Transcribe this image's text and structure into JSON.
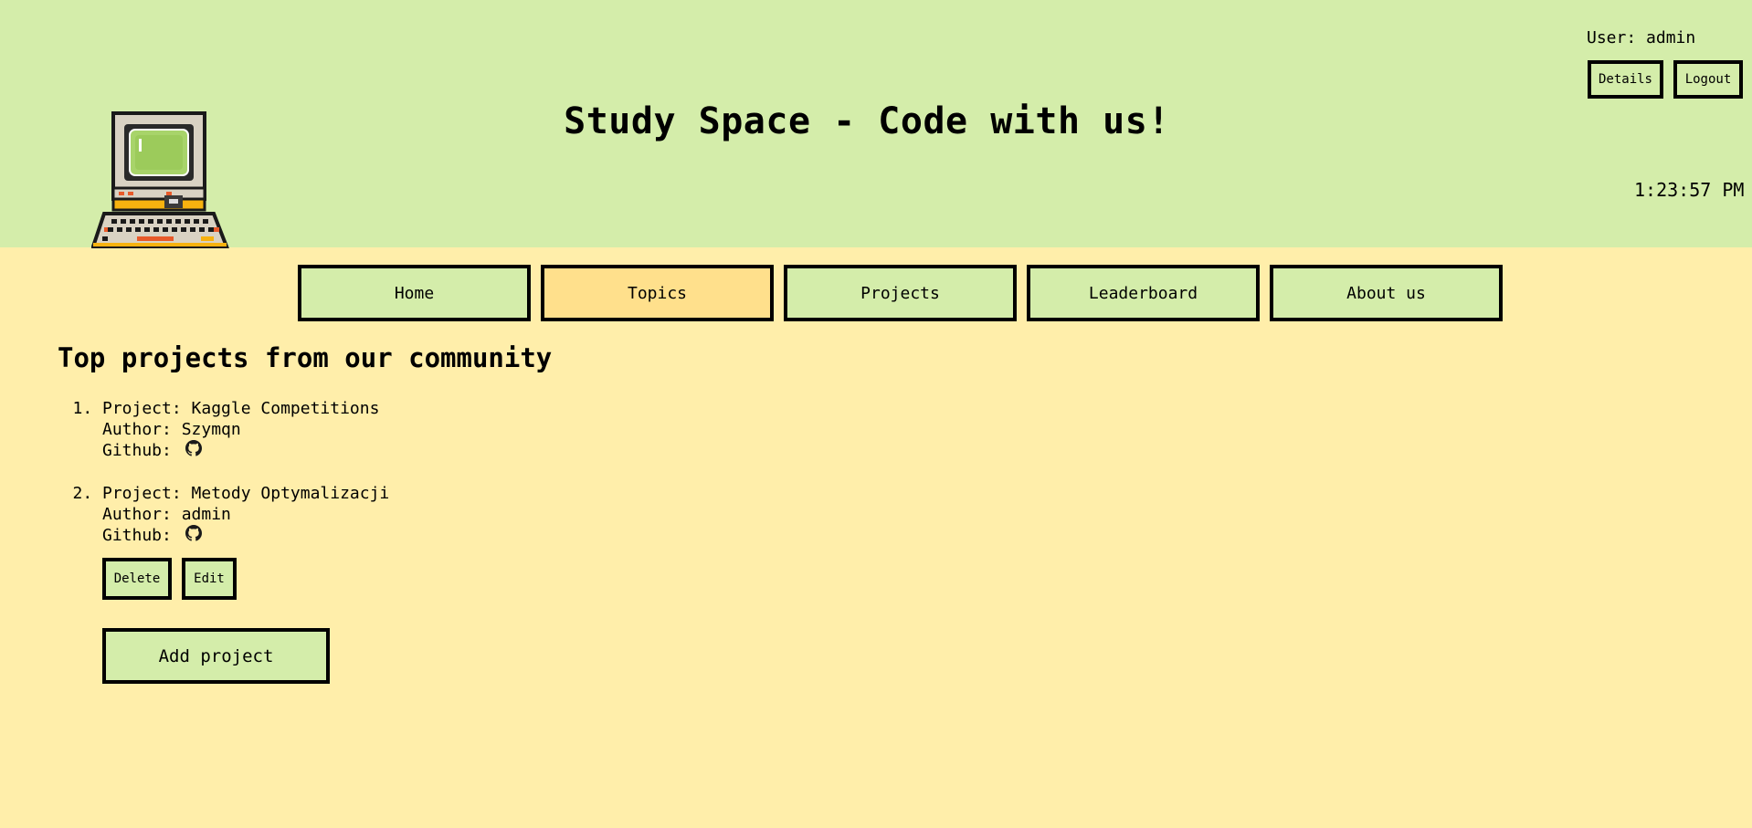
{
  "header": {
    "title": "Study Space - Code with us!",
    "user_text": "User: admin",
    "details_label": "Details",
    "logout_label": "Logout",
    "clock": "1:23:57 PM",
    "logo_icon": "retro-computer-icon"
  },
  "nav": {
    "items": [
      {
        "label": "Home"
      },
      {
        "label": "Topics"
      },
      {
        "label": "Projects"
      },
      {
        "label": "Leaderboard"
      },
      {
        "label": "About us"
      }
    ],
    "active": "Topics"
  },
  "main": {
    "heading": "Top projects from our community",
    "projects": [
      {
        "project_line": "Project: Kaggle Competitions",
        "author_line": "Author: Szymqn",
        "github_label": "Github:",
        "github_icon": "github-icon"
      },
      {
        "project_line": "Project: Metody Optymalizacji",
        "author_line": "Author: admin",
        "github_label": "Github:",
        "github_icon": "github-icon",
        "delete_label": "Delete",
        "edit_label": "Edit"
      }
    ],
    "add_project_label": "Add project"
  },
  "colors": {
    "header_bg": "#d4edaa",
    "page_bg": "#ffeeaa",
    "active_tab": "#ffe08c",
    "border": "#000000"
  }
}
